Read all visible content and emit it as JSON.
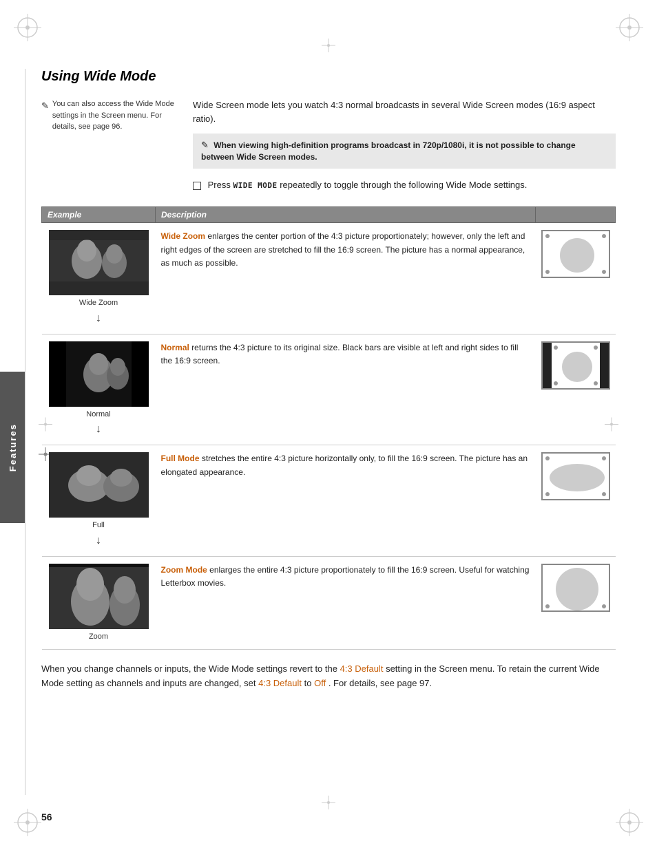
{
  "page": {
    "number": "56",
    "title": "Using Wide Mode"
  },
  "intro": {
    "main_text": "Wide Screen mode lets you watch 4:3 normal broadcasts in several Wide Screen modes (16:9 aspect ratio).",
    "note_text": "When viewing high-definition programs broadcast in 720p/1080i, it is not possible to change between Wide Screen modes.",
    "press_instruction_pre": "Press",
    "press_instruction_key": "WIDE MODE",
    "press_instruction_post": "repeatedly to toggle through the following Wide Mode settings.",
    "side_note": "You can also access the Wide Mode settings in the Screen menu. For details, see page 96."
  },
  "table": {
    "col_example": "Example",
    "col_description": "Description",
    "rows": [
      {
        "name": "Wide Zoom",
        "caption": "Wide Zoom",
        "description": "Wide Zoom enlarges the center portion of the 4:3 picture proportionately; however, only the left and right edges of the screen are stretched to fill the 16:9 screen. The picture has a normal appearance, as much as possible.",
        "desc_highlight": "Wide Zoom",
        "diagram_type": "normal"
      },
      {
        "name": "Normal",
        "caption": "Normal",
        "description": "Normal returns the 4:3 picture to its original size. Black bars are visible at left and right sides to fill the 16:9 screen.",
        "desc_highlight": "Normal",
        "diagram_type": "black-sides"
      },
      {
        "name": "Full",
        "caption": "Full",
        "description": "Full Mode stretches the entire 4:3 picture horizontally only, to fill the 16:9 screen. The picture has an elongated appearance.",
        "desc_highlight": "Full Mode",
        "diagram_type": "wide-oval"
      },
      {
        "name": "Zoom",
        "caption": "Zoom",
        "description": "Zoom Mode enlarges the entire 4:3 picture proportionately to fill the 16:9 screen. Useful for watching Letterbox movies.",
        "desc_highlight": "Zoom Mode",
        "diagram_type": "zoom"
      }
    ]
  },
  "bottom_text": "When you change channels or inputs, the Wide Mode settings revert to the 4:3 Default setting in the Screen menu. To retain the current Wide Mode setting as channels and inputs are changed, set 4:3 Default to Off. For details, see page 97.",
  "highlight_terms": [
    "4:3 Default",
    "Off"
  ],
  "side_tab": {
    "label": "Features"
  }
}
